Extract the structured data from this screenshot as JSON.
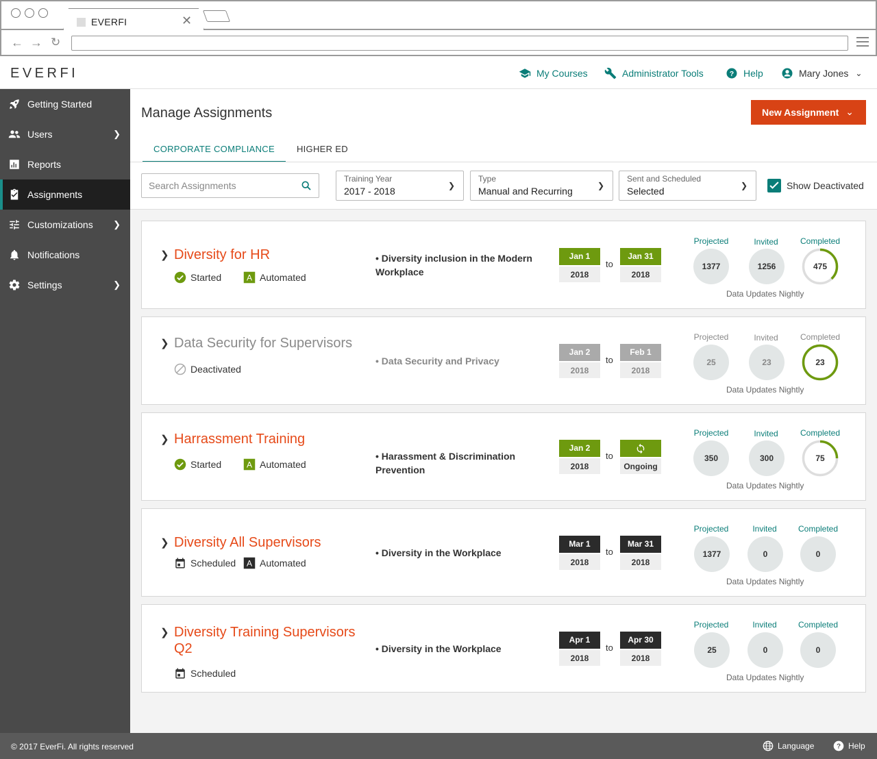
{
  "browser": {
    "tab_title": "EVERFI",
    "close_glyph": "✕"
  },
  "header": {
    "logo": "EVERFI",
    "my_courses": "My Courses",
    "admin_tools": "Administrator Tools",
    "help": "Help",
    "user": "Mary Jones"
  },
  "sidebar": {
    "items": [
      {
        "label": "Getting Started",
        "icon": "rocket-icon"
      },
      {
        "label": "Users",
        "icon": "users-icon"
      },
      {
        "label": "Reports",
        "icon": "chart-icon"
      },
      {
        "label": "Assignments",
        "icon": "clipboard-check-icon"
      },
      {
        "label": "Customizations",
        "icon": "sliders-icon"
      },
      {
        "label": "Notifications",
        "icon": "bell-icon"
      },
      {
        "label": "Settings",
        "icon": "gear-icon"
      }
    ]
  },
  "page": {
    "title": "Manage Assignments",
    "new_button": "New Assignment",
    "tabs": [
      "CORPORATE COMPLIANCE",
      "HIGHER ED"
    ],
    "search_placeholder": "Search Assignments",
    "filters": {
      "year_label": "Training Year",
      "year_value": "2017 - 2018",
      "type_label": "Type",
      "type_value": "Manual and Recurring",
      "sent_label": "Sent and Scheduled",
      "sent_value": "Selected"
    },
    "show_deactivated": "Show Deactivated"
  },
  "stat_labels": {
    "projected": "Projected",
    "invited": "Invited",
    "completed": "Completed",
    "updates": "Data Updates Nightly",
    "to": "to"
  },
  "assignments": [
    {
      "title": "Diversity for HR",
      "status": "Started",
      "mode": "Automated",
      "course": "• Diversity inclusion in the Modern Workplace",
      "start_top": "Jan 1",
      "start_bot": "2018",
      "end_top": "Jan 31",
      "end_bot": "2018",
      "projected": "1377",
      "invited": "1256",
      "completed": "475",
      "completed_fraction": 0.38
    },
    {
      "title": "Data Security for Supervisors",
      "status": "Deactivated",
      "course": "• Data Security and Privacy",
      "start_top": "Jan 2",
      "start_bot": "2018",
      "end_top": "Feb 1",
      "end_bot": "2018",
      "projected": "25",
      "invited": "23",
      "completed": "23",
      "completed_fraction": 1.0
    },
    {
      "title": "Harrassment Training",
      "status": "Started",
      "mode": "Automated",
      "course": "• Harassment & Discrimination Prevention",
      "start_top": "Jan 2",
      "start_bot": "2018",
      "end_bot": "Ongoing",
      "projected": "350",
      "invited": "300",
      "completed": "75",
      "completed_fraction": 0.25
    },
    {
      "title": "Diversity All Supervisors",
      "status": "Scheduled",
      "mode": "Automated",
      "course": "• Diversity in the Workplace",
      "start_top": "Mar 1",
      "start_bot": "2018",
      "end_top": "Mar 31",
      "end_bot": "2018",
      "projected": "1377",
      "invited": "0",
      "completed": "0"
    },
    {
      "title": "Diversity Training Supervisors Q2",
      "status": "Scheduled",
      "course": "• Diversity in the Workplace",
      "start_top": "Apr 1",
      "start_bot": "2018",
      "end_top": "Apr 30",
      "end_bot": "2018",
      "projected": "25",
      "invited": "0",
      "completed": "0"
    }
  ],
  "footer": {
    "copyright": "© 2017 EverFi. All rights reserved",
    "language": "Language",
    "help": "Help"
  },
  "colors": {
    "accent": "#0a7d78",
    "brand": "#d84315",
    "title_red": "#e64a19",
    "green": "#6e9a0f"
  }
}
